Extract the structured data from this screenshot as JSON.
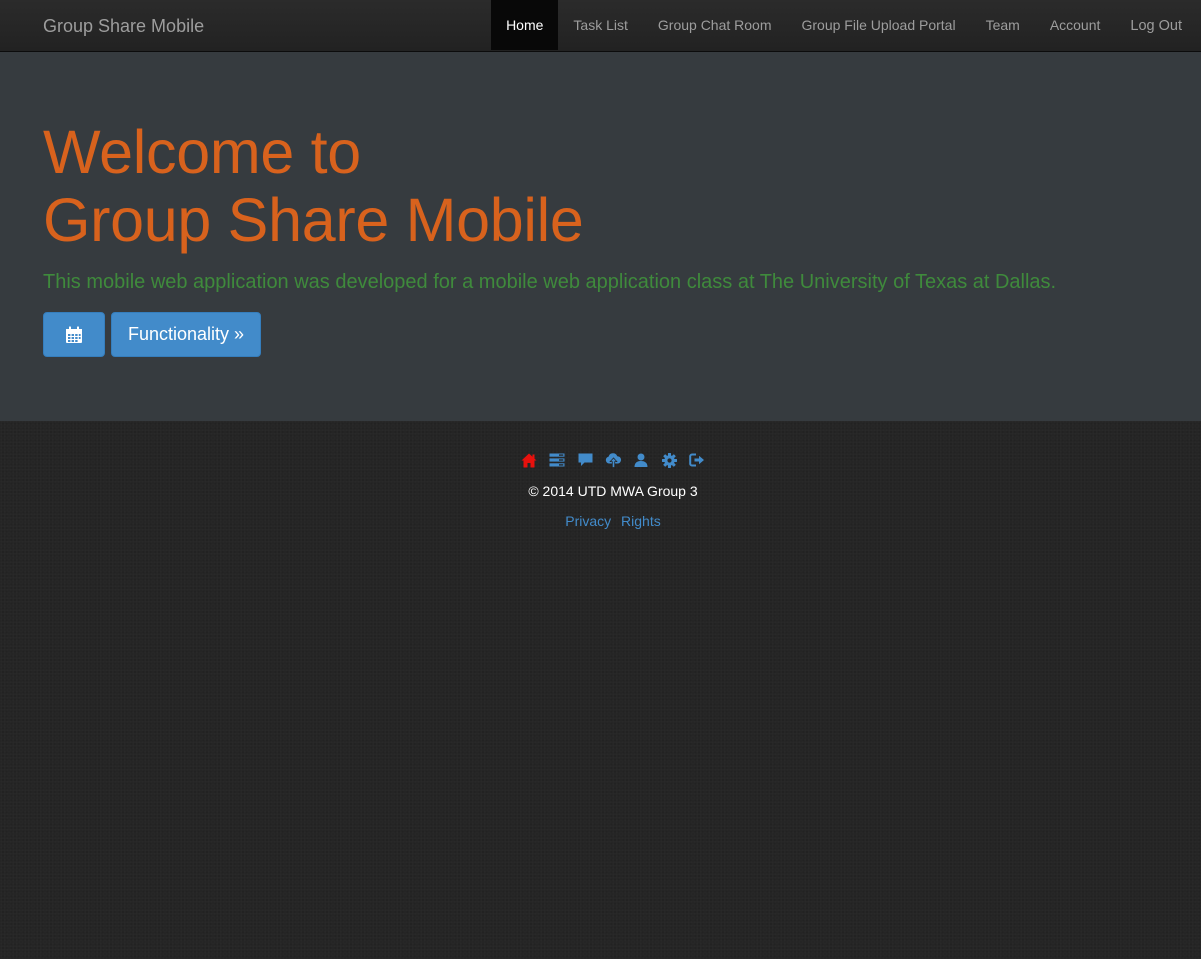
{
  "navbar": {
    "brand": "Group Share Mobile",
    "items": [
      {
        "label": "Home",
        "active": true
      },
      {
        "label": "Task List"
      },
      {
        "label": "Group Chat Room"
      },
      {
        "label": "Group File Upload Portal"
      },
      {
        "label": "Team"
      },
      {
        "label": "Account"
      },
      {
        "label": "Log Out"
      }
    ]
  },
  "hero": {
    "title_line1": "Welcome to",
    "title_line2": "Group Share Mobile",
    "lead": "This mobile web application was developed for a mobile web application class at The University of Texas at Dallas.",
    "calendar_icon": "calendar-icon",
    "functionality_label": "Functionality »"
  },
  "footer": {
    "icons": [
      "home-icon",
      "tasks-icon",
      "chat-icon",
      "cloud-upload-icon",
      "user-icon",
      "gear-icon",
      "logout-icon"
    ],
    "copyright": "© 2014 UTD MWA Group 3",
    "links": {
      "privacy": "Privacy",
      "rights": "Rights"
    }
  },
  "colors": {
    "title": "#d8621d",
    "lead": "#3f8a3c",
    "primary": "#428bca",
    "home_icon": "#e8110d",
    "jumbotron_bg": "#363b3f",
    "navbar_bg": "#222222"
  }
}
